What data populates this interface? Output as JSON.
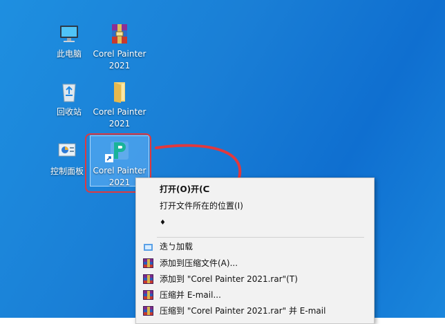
{
  "desktop": {
    "icons": [
      {
        "label": "此电脑"
      },
      {
        "label": "Corel Painter 2021"
      },
      {
        "label": "回收站"
      },
      {
        "label": "Corel Painter 2021"
      },
      {
        "label": "控制面板"
      },
      {
        "label": "Corel Painter 2021"
      }
    ]
  },
  "context_menu": {
    "items": [
      {
        "label": "打开(O)开(ᑕ"
      },
      {
        "label": "打开文件所在的位置(I)"
      },
      {
        "label": "♦"
      },
      {
        "label": "迭ㄅ加载"
      },
      {
        "label": "添加到压缩文件(A)..."
      },
      {
        "label": "添加到 \"Corel Painter 2021.rar\"(T)"
      },
      {
        "label": "压缩并 E-mail..."
      },
      {
        "label": "压缩到 \"Corel Painter 2021.rar\" 并 E-mail"
      }
    ]
  },
  "colors": {
    "annotation_red": "#e0393e",
    "desktop_blue": "#1a7fd6",
    "menu_bg": "#f2f2f2"
  }
}
